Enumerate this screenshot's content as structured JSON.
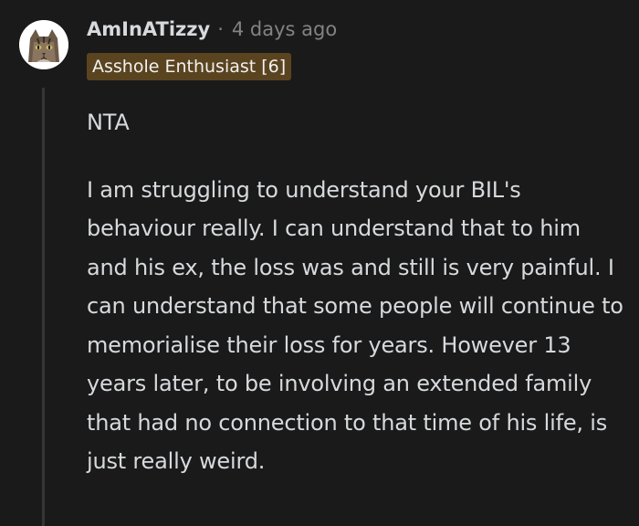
{
  "comment": {
    "author": "AmInATizzy",
    "separator": "·",
    "timestamp": "4 days ago",
    "flair": "Asshole Enthusiast [6]",
    "paragraphs": [
      "NTA",
      "I am struggling to understand your BIL's behaviour really. I can understand that to him and his ex, the loss was and still is very painful. I can understand that some people will continue to memorialise their loss for years. However 13 years later, to be involving an extended family that had no connection to that time of his life, is just really weird."
    ],
    "avatar_icon": "cat-avatar-icon"
  },
  "colors": {
    "background": "#1a1a1b",
    "text": "#d7dadc",
    "muted": "#818384",
    "flair_bg": "#5a4420",
    "thread_line": "#343536"
  }
}
